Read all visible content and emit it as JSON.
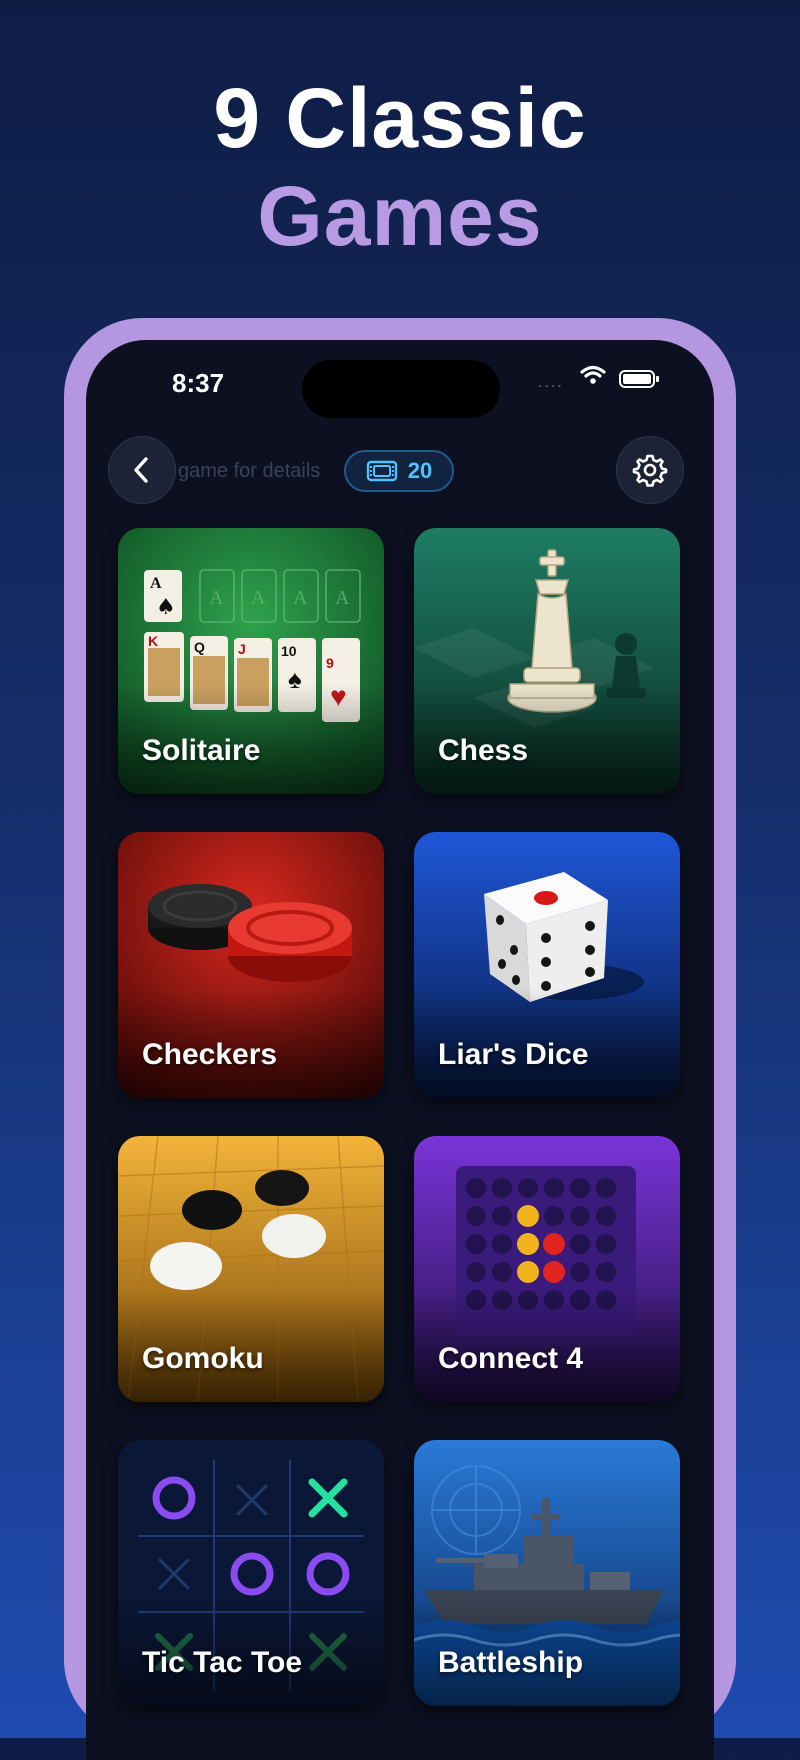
{
  "headline": {
    "line1": "9 Classic",
    "line2": "Games"
  },
  "status_bar": {
    "time": "8:37",
    "signal": "....",
    "wifi_icon": "wifi-icon",
    "battery_icon": "battery-icon"
  },
  "topbar": {
    "back_icon": "chevron-left-icon",
    "hint_text": "game for details",
    "tickets": {
      "icon": "ticket-icon",
      "count": "20"
    },
    "settings_icon": "gear-icon"
  },
  "games": [
    {
      "name": "Solitaire",
      "accent": "#1e8a3e"
    },
    {
      "name": "Chess",
      "accent": "#1b6e5a"
    },
    {
      "name": "Checkers",
      "accent": "#b81e18"
    },
    {
      "name": "Liar's Dice",
      "accent": "#1c48b8"
    },
    {
      "name": "Gomoku",
      "accent": "#e8a020"
    },
    {
      "name": "Connect 4",
      "accent": "#6a28c0"
    },
    {
      "name": "Tic Tac Toe",
      "accent": "#0c1838"
    },
    {
      "name": "Battleship",
      "accent": "#1f6cc0"
    }
  ]
}
